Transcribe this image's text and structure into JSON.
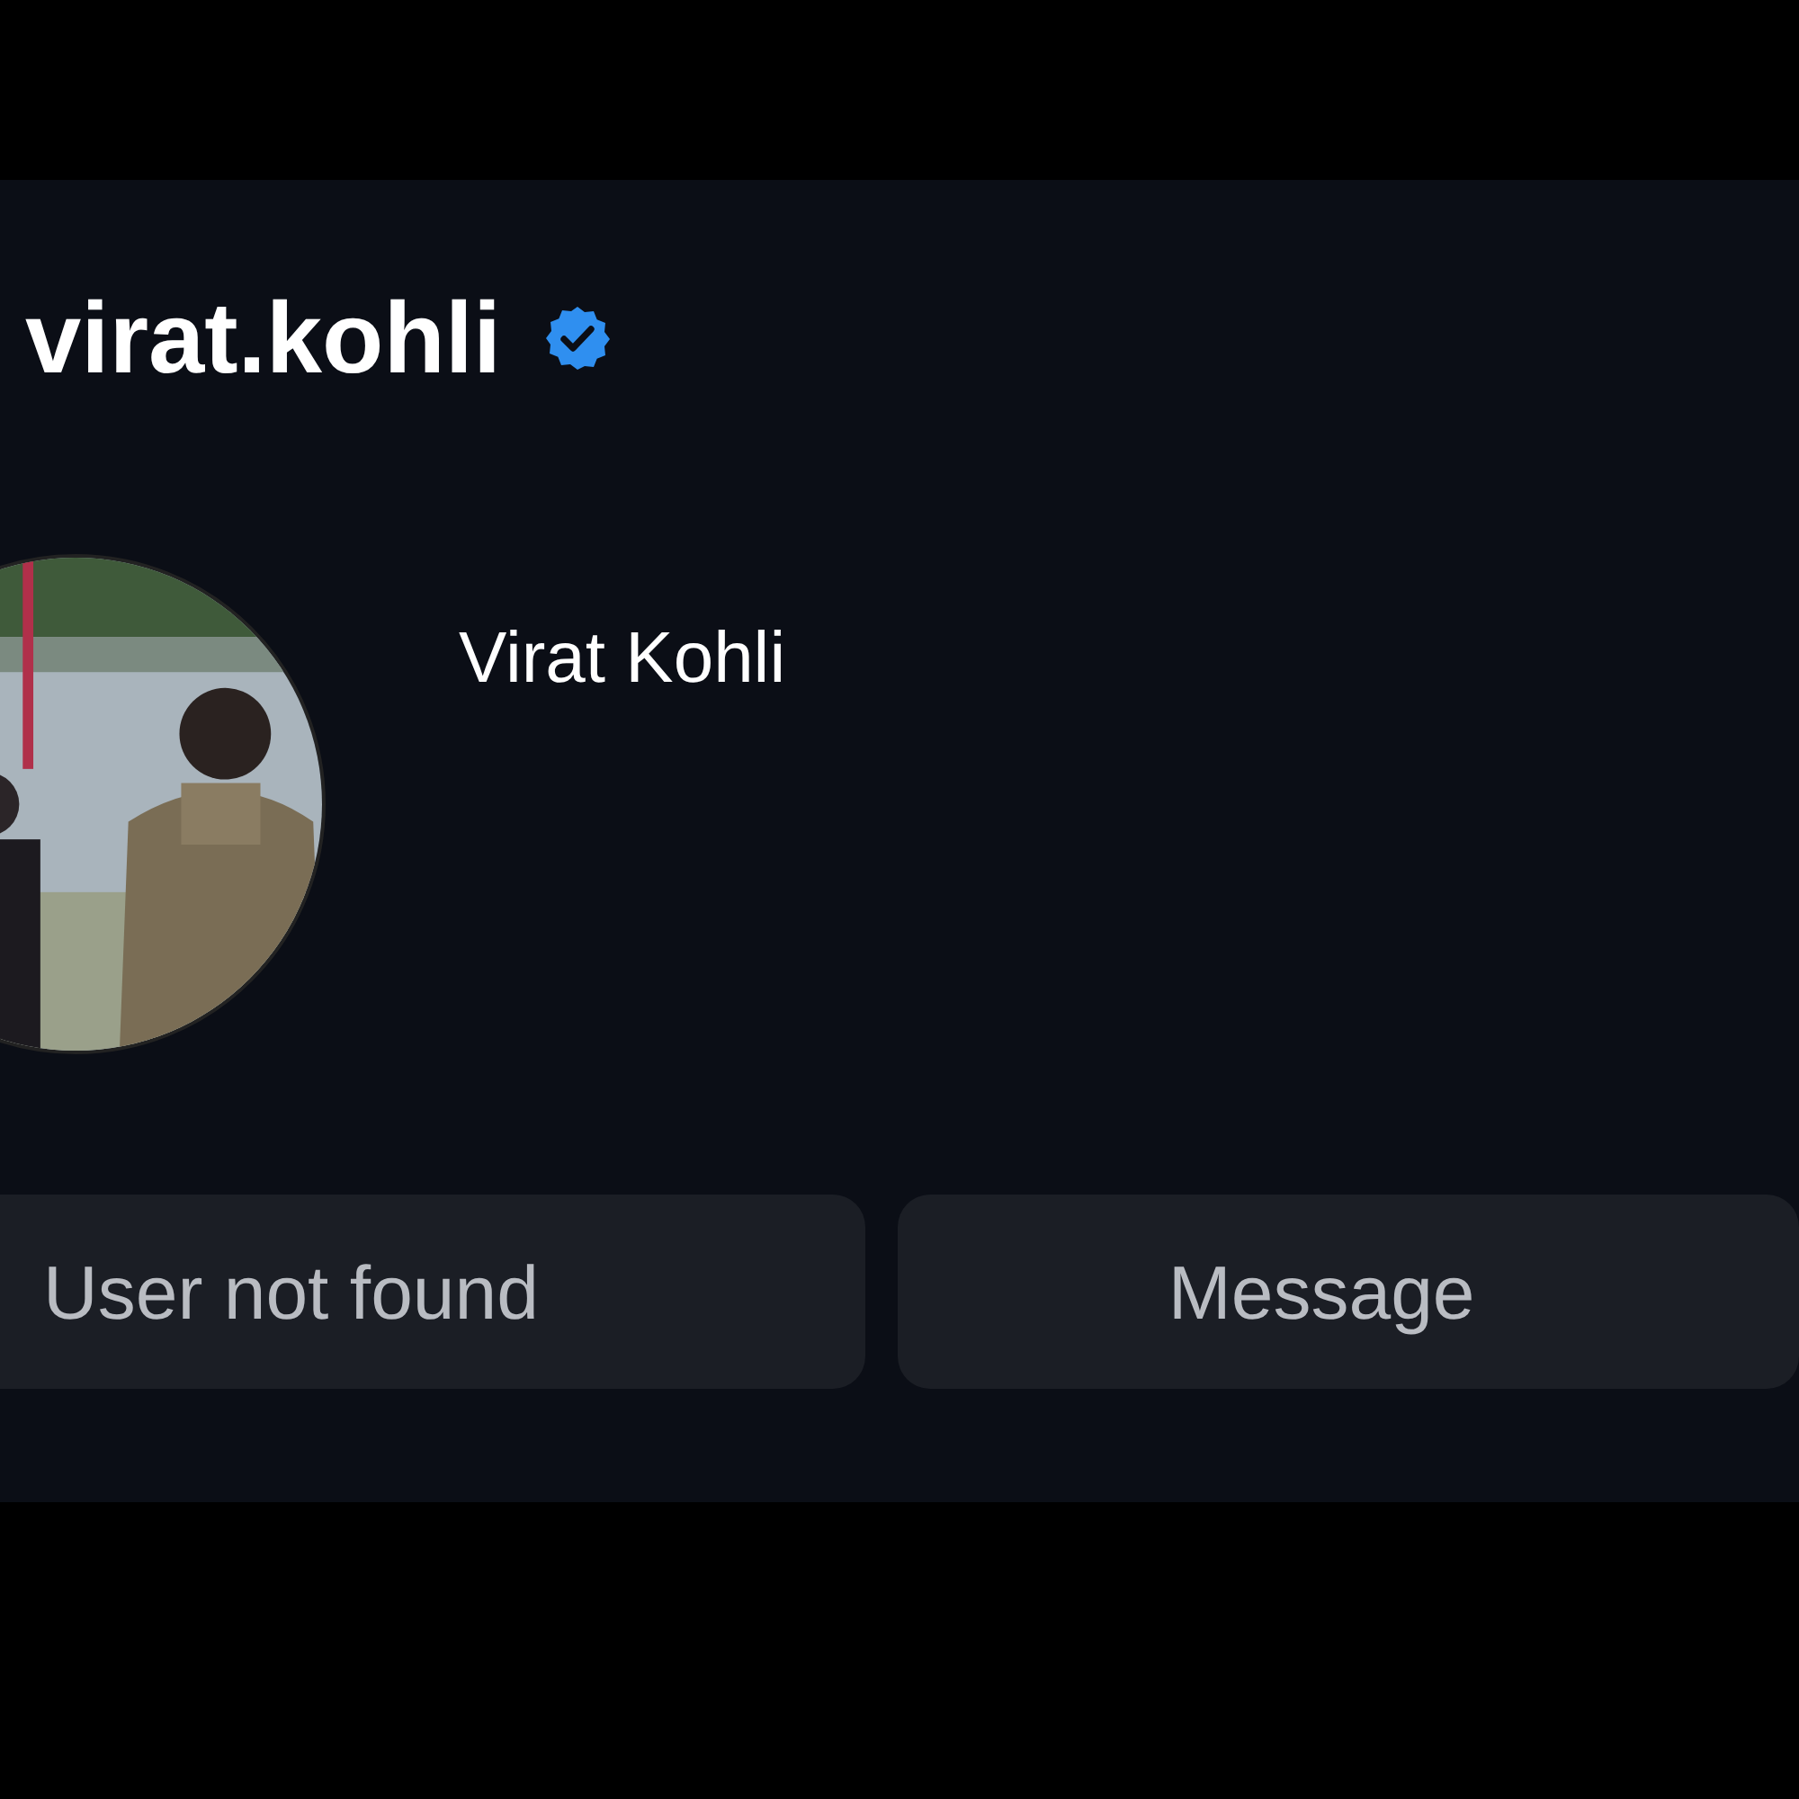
{
  "profile": {
    "username": "virat.kohli",
    "verified": true,
    "full_name": "Virat Kohli"
  },
  "buttons": [
    {
      "label": "User not found",
      "kind": "status"
    },
    {
      "label": "Message",
      "kind": "action"
    }
  ]
}
